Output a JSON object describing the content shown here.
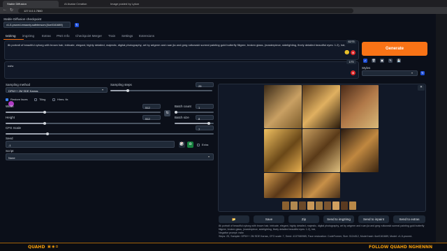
{
  "browser": {
    "tabs": [
      "Stable Diffusion",
      "AI Avatar Creation",
      "Image posted by Lykon"
    ],
    "url": "127.0.0.1:7860"
  },
  "checkpoint": {
    "label": "Stable Diffusion checkpoint",
    "value": "v1-5-pruned-emaonly.safetensors [6ce0161689]"
  },
  "tabs": [
    "txt2img",
    "img2img",
    "Extras",
    "PNG Info",
    "Checkpoint Merger",
    "Train",
    "Settings",
    "Extensions"
  ],
  "prompt": {
    "text": "8k portrait of beautiful cyborg with brown hair, intricate, elegant, highly detailed, majestic, digital photography, art by artgerm and ruan jia and greg rutkowski surreal painting gold butterfly filigree, broken glass, (masterpiece, sidelighting, finely detailed beautiful eyes: 1.2), hdr,",
    "counter": "62/75"
  },
  "negative_prompt": {
    "text": "nsfw",
    "counter": "1/75"
  },
  "generate_label": "Generate",
  "styles_label": "Styles",
  "sampling_method": {
    "label": "Sampling method",
    "value": "DPM++ 2M SDE Karras"
  },
  "sampling_steps": {
    "label": "Sampling steps",
    "value": "25",
    "fraction": 0.17
  },
  "options": {
    "restore_faces": "Restore faces",
    "tiling": "Tiling",
    "hires_fix": "Hires. fix"
  },
  "width": {
    "label": "Width",
    "value": "512",
    "fraction": 0.25
  },
  "height": {
    "label": "Height",
    "value": "512",
    "fraction": 0.25
  },
  "batch_count": {
    "label": "Batch count",
    "value": "1",
    "fraction": 0.0
  },
  "batch_size": {
    "label": "Batch size",
    "value": "8",
    "fraction": 0.88
  },
  "cfg_scale": {
    "label": "CFG Scale",
    "value": "7",
    "fraction": 0.2
  },
  "seed": {
    "label": "Seed",
    "value": "-1",
    "extra_label": "Extra"
  },
  "script": {
    "label": "Script",
    "value": "None"
  },
  "actions": [
    "Save",
    "Zip",
    "Send to img2img",
    "Send to inpaint",
    "Send to extras"
  ],
  "info": {
    "prompt": "8k portrait of beautiful cyborg with brown hair, intricate, elegant, highly detailed, majestic, digital photography, art by artgerm and ruan jia and greg rutkowski surreal painting gold butterfly filigree, broken glass, (masterpiece, sidelighting, finely detailed beautiful eyes: 1.2), hdr,",
    "negative": "Negative prompt: nsfw",
    "params": "Steps: 25, Sampler: DPM++ 2M SDE Karras, CFG scale: 7, Seed: 4137080985, Face restoration: CodeFormer, Size: 512x512, Model hash: 6ce0161689, Model: v1-5-pruned-"
  },
  "footer": {
    "left": "QUAHD",
    "right": "FOLLOW QUAHD NGHENNN"
  },
  "colors": {
    "accent": "#f97316",
    "gold": "#f59e0b",
    "bg": "#0b0f19"
  }
}
